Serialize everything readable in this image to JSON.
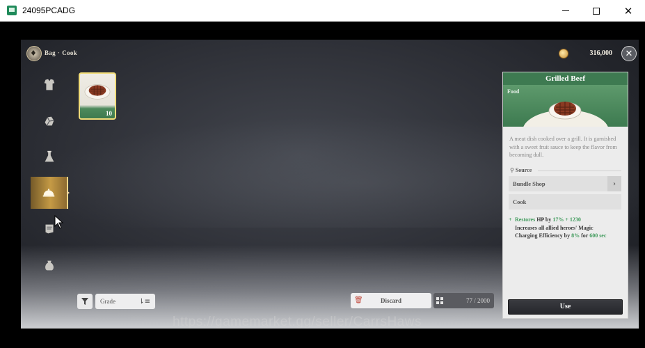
{
  "window": {
    "title": "24095PCADG"
  },
  "header": {
    "breadcrumb": [
      "Bag",
      "Cook"
    ],
    "separator": "·",
    "gold": "316,000"
  },
  "sidebar": {
    "items": [
      {
        "name": "equipment",
        "icon": "armor-icon",
        "active": false
      },
      {
        "name": "materials",
        "icon": "ore-icon",
        "active": false
      },
      {
        "name": "consumables",
        "icon": "flask-icon",
        "active": false
      },
      {
        "name": "cook",
        "icon": "cloche-icon",
        "active": true
      },
      {
        "name": "scrolls",
        "icon": "scroll-icon",
        "active": false
      },
      {
        "name": "misc",
        "icon": "pouch-icon",
        "active": false
      }
    ]
  },
  "inventory": {
    "items": [
      {
        "name": "Grilled Beef",
        "icon": "steak-icon",
        "count": "10",
        "selected": true
      }
    ]
  },
  "controls": {
    "grade_label": "Grade",
    "discard_label": "Discard",
    "capacity": "77 / 2000"
  },
  "detail": {
    "title": "Grilled Beef",
    "category": "Food",
    "description": "A meat dish cooked over a grill. It is garnished with a sweet fruit sauce to keep the flavor from becoming dull.",
    "source_title": "Source",
    "sources": [
      "Bundle Shop",
      "Cook"
    ],
    "effect": {
      "line1": {
        "a": "Restores",
        "b": " HP by ",
        "c": "17%",
        "d": " + ",
        "e": "1230"
      },
      "line2": "Increases all allied heroes' Magic",
      "line3": {
        "a": "Charging Efficiency by ",
        "b": "8%",
        "c": " for ",
        "d": "600 sec"
      }
    },
    "use_label": "Use"
  },
  "watermark": "https://gamemarket.gg/seller/CarrsHaws",
  "colors": {
    "accent_green": "#3e7a51",
    "highlight_gold": "#f2dd7a",
    "effect_green": "#3f9a5b"
  }
}
